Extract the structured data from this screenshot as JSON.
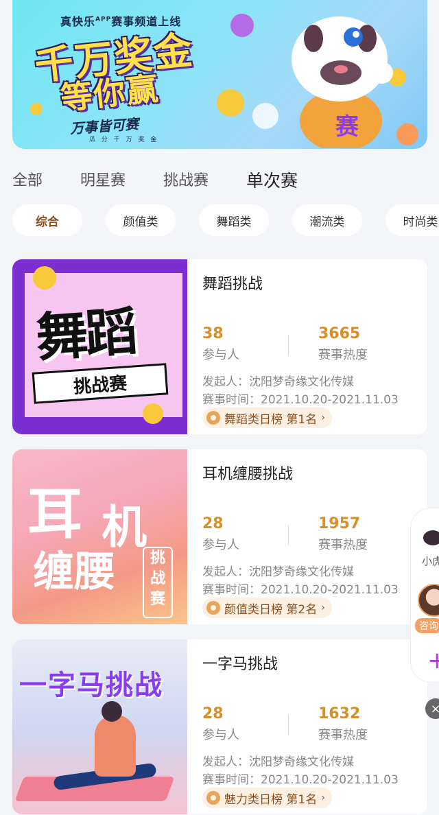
{
  "banner": {
    "channel_prefix": "真快乐",
    "channel_app": "APP",
    "channel_suffix": "赛事频道上线",
    "headline_1": "千万奖金",
    "headline_2": "等你赢",
    "slogan": "万事皆可赛",
    "sub": "瓜 分 千 万 奖 金",
    "mascot_text": "赛"
  },
  "tabs": [
    "全部",
    "明星赛",
    "挑战赛",
    "单次赛"
  ],
  "chips": [
    "综合",
    "颜值类",
    "舞蹈类",
    "潮流类",
    "时尚类"
  ],
  "cards": [
    {
      "title": "舞蹈挑战",
      "participants": "38",
      "participants_label": "参与人",
      "heat": "3665",
      "heat_label": "赛事热度",
      "organizer": "发起人：沈阳梦奇缘文化传媒",
      "time": "赛事时间：2021.10.20-2021.11.03",
      "rank": "舞蹈类日榜 第1名",
      "thumb_line1": "舞蹈",
      "thumb_line2": "挑战赛"
    },
    {
      "title": "耳机缠腰挑战",
      "participants": "28",
      "participants_label": "参与人",
      "heat": "1957",
      "heat_label": "赛事热度",
      "organizer": "发起人：沈阳梦奇缘文化传媒",
      "time": "赛事时间：2021.10.20-2021.11.03",
      "rank": "颜值类日榜 第2名",
      "thumb_w1": "耳",
      "thumb_w2": "机",
      "thumb_w3": "缠腰",
      "thumb_w4": "挑战赛"
    },
    {
      "title": "一字马挑战",
      "participants": "28",
      "participants_label": "参与人",
      "heat": "1632",
      "heat_label": "赛事热度",
      "organizer": "发起人：沈阳梦奇缘文化传媒",
      "time": "赛事时间：2021.10.20-2021.11.03",
      "rank": "魅力类日榜 第1名",
      "thumb_line1": "一字马挑战"
    }
  ],
  "side": {
    "label": "小虎",
    "ask": "咨询",
    "plus": "+"
  },
  "close": "×",
  "chevron": "›"
}
